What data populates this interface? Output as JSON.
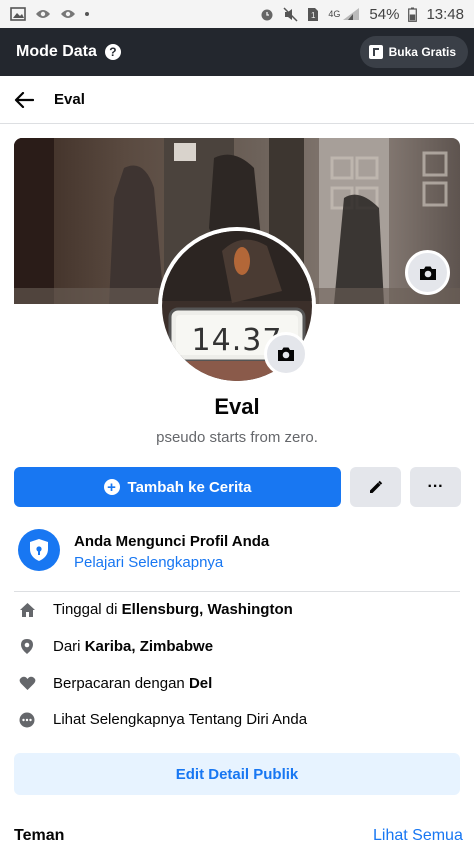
{
  "status_bar": {
    "battery": "54%",
    "time": "13:48",
    "network": "4G"
  },
  "data_mode": {
    "title": "Mode Data",
    "help_label": "?",
    "free_button": "Buka Gratis"
  },
  "header": {
    "title": "Eval"
  },
  "profile": {
    "name": "Eval",
    "bio": "pseudo starts from zero.",
    "avatar_text": "14.37"
  },
  "actions": {
    "add_story": "Tambah ke Cerita",
    "more": "···"
  },
  "lock_notice": {
    "title": "Anda Mengunci Profil Anda",
    "link": "Pelajari Selengkapnya"
  },
  "details": {
    "lives": {
      "prefix": "Tinggal di",
      "value": "Ellensburg, Washington"
    },
    "from": {
      "prefix": "Dari",
      "value": "Kariba, Zimbabwe"
    },
    "relationship": {
      "prefix": "Berpacaran dengan",
      "value": "Del"
    },
    "see_more": "Lihat Selengkapnya Tentang Diri Anda"
  },
  "edit_public": "Edit Detail Publik",
  "friends": {
    "title": "Teman",
    "see_all": "Lihat Semua"
  },
  "colors": {
    "accent": "#1877f2",
    "dark_bar": "#23272e",
    "button_gray": "#e4e6eb",
    "light_blue": "#e7f3ff"
  }
}
